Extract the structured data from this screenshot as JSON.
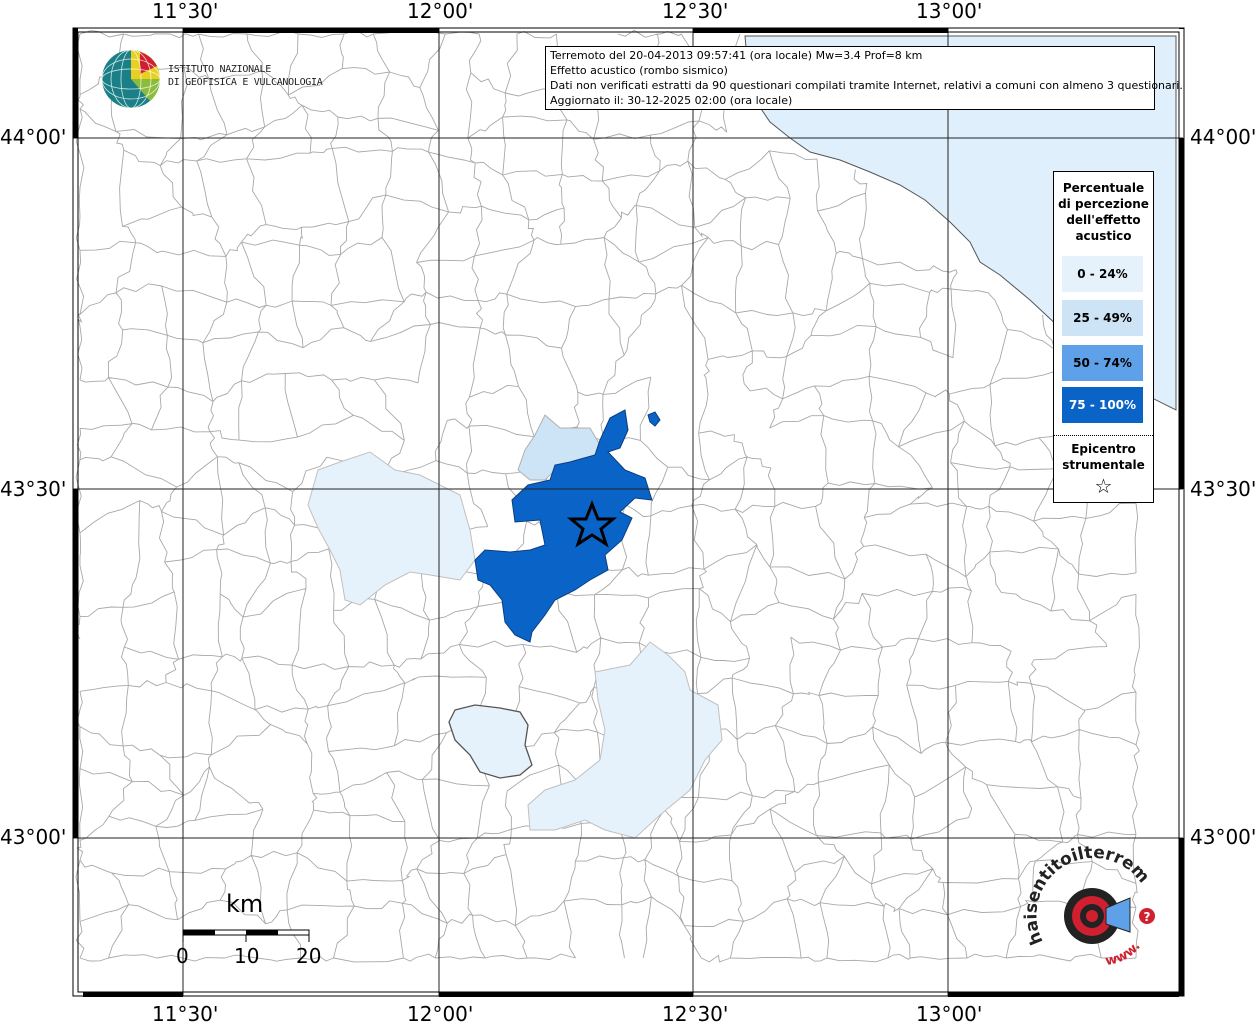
{
  "map": {
    "title_lines": [
      "Terremoto del 20-04-2013 09:57:41 (ora locale) Mw=3.4 Prof=8 km",
      "Effetto acustico (rombo sismico)",
      "Dati non verificati estratti da 90 questionari compilati tramite Internet, relativi a comuni con almeno 3 questionari.",
      "Aggiornato il: 30-12-2025 02:00 (ora locale)"
    ],
    "institute_logo_text": [
      "ISTITUTO NAZIONALE",
      "DI GEOFISICA E VULCANOLOGIA"
    ],
    "axes": {
      "longitude_labels": [
        "11°30'",
        "12°00'",
        "12°30'",
        "13°00'"
      ],
      "latitude_labels": [
        "44°00'",
        "43°30'",
        "43°00'"
      ]
    },
    "legend": {
      "title": [
        "Percentuale",
        "di percezione",
        "dell'effetto",
        "acustico"
      ],
      "classes": [
        {
          "label": "0 - 24%",
          "color": "#e6f2fb"
        },
        {
          "label": "25 - 49%",
          "color": "#cde3f6"
        },
        {
          "label": "50 - 74%",
          "color": "#5fa1e8"
        },
        {
          "label": "75 - 100%",
          "color": "#0a64c8"
        }
      ],
      "epicenter_label": [
        "Epicentro",
        "strumentale"
      ],
      "epicenter_icon": "star-icon"
    },
    "scale_bar": {
      "unit": "km",
      "ticks": [
        "0",
        "10",
        "20"
      ]
    },
    "site_logo_text": "haisentitoilterremoto.it",
    "site_logo_url_text": "www.",
    "colors": {
      "sea": "#dff0fc",
      "municipality_border": "#9a9a9a",
      "grid": "#222222",
      "epicenter_star": "#000000"
    }
  }
}
